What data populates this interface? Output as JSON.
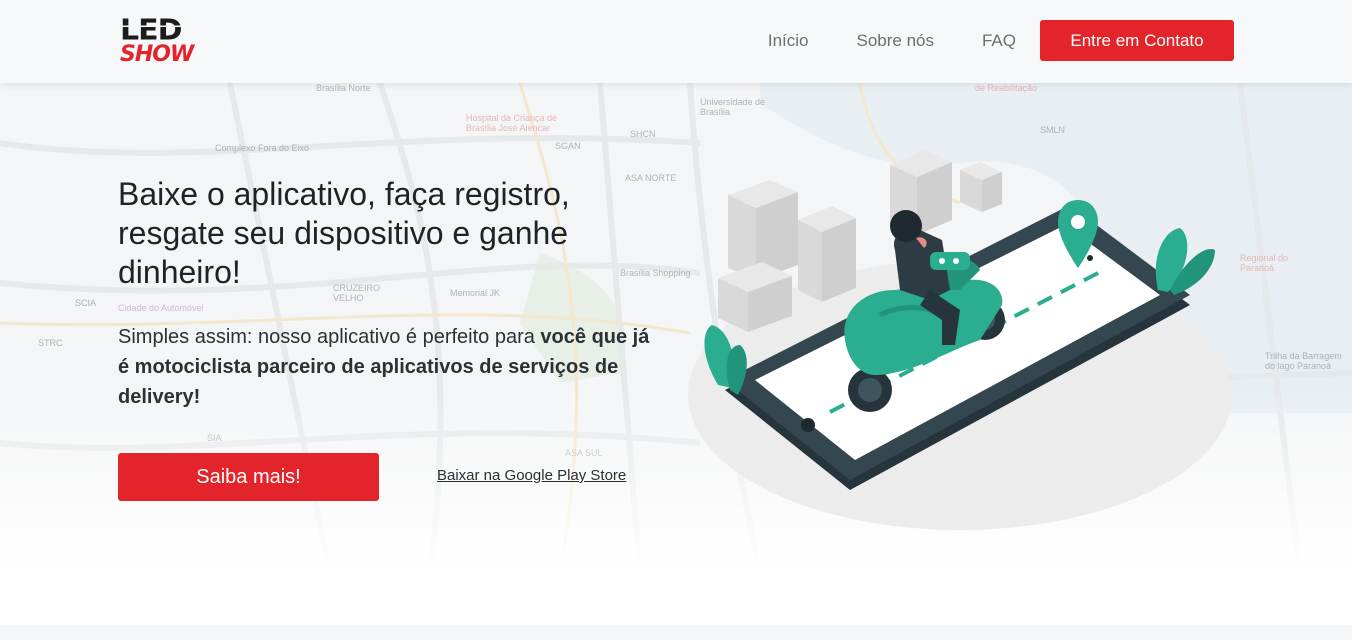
{
  "brand": {
    "logo_top": "LED",
    "logo_bottom": "SHOW",
    "accent": "#e3242b"
  },
  "nav": {
    "items": [
      {
        "label": "Início"
      },
      {
        "label": "Sobre nós"
      },
      {
        "label": "FAQ"
      }
    ],
    "cta_label": "Entre em Contato"
  },
  "hero": {
    "title": "Baixe o aplicativo, faça registro, resgate seu dispositivo e ganhe dinheiro!",
    "text_regular": "Simples assim: nosso aplicativo é perfeito para ",
    "text_bold": "você que já é motociclista parceiro de aplicativos de serviços de delivery!",
    "button_label": "Saiba mais!",
    "store_link_label": "Baixar na Google Play Store"
  },
  "map": {
    "labels": [
      "Brasília Norte",
      "Hospital da Criança de Brasília José Alencar",
      "Complexo Fora do Eixo",
      "SGAN",
      "SHCN",
      "ASA NORTE",
      "Universidade de Brasília",
      "SMLN",
      "Cidade do Automóvel",
      "SCIA",
      "CRUZEIRO VELHO",
      "Memorial JK",
      "Brasília Shopping",
      "SIA",
      "ASA SUL",
      "Regional do Paranoá",
      "Trilha da Barragem do lago Paranoá",
      "de Reabilitação",
      "STRC"
    ]
  }
}
